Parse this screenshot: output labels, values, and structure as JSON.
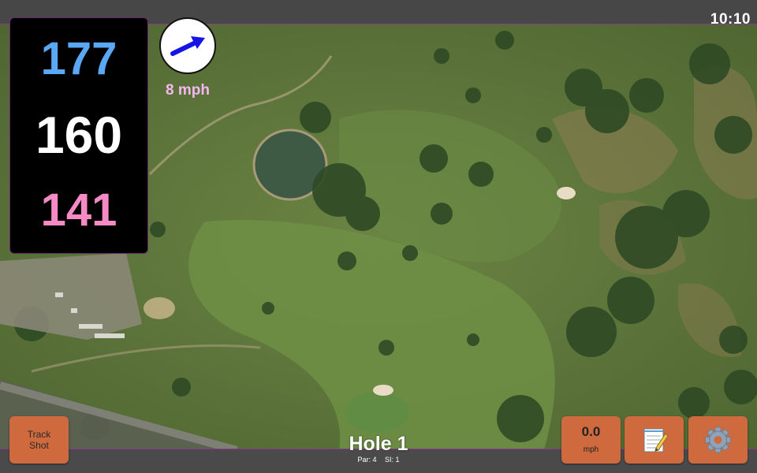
{
  "status_bar": {
    "time": "10:10"
  },
  "yardages": {
    "back": "177",
    "center": "160",
    "front": "141"
  },
  "wind": {
    "speed_label": "8 mph",
    "direction_icon": "wind-arrow-icon",
    "arrow_color": "#1414e6"
  },
  "buttons": {
    "track_shot_line1": "Track",
    "track_shot_line2": "Shot",
    "speed_value": "0.0",
    "speed_unit": "mph",
    "notes_icon": "notepad-icon",
    "settings_icon": "gear-icon"
  },
  "hole": {
    "title": "Hole 1",
    "par_label": "Par: 4",
    "si_label": "SI: 1"
  },
  "colors": {
    "back_yardage": "#5aa8f5",
    "center_yardage": "#ffffff",
    "front_yardage": "#f58ac5",
    "button": "#cf6a3e",
    "wind_label": "#f3b8f0"
  }
}
